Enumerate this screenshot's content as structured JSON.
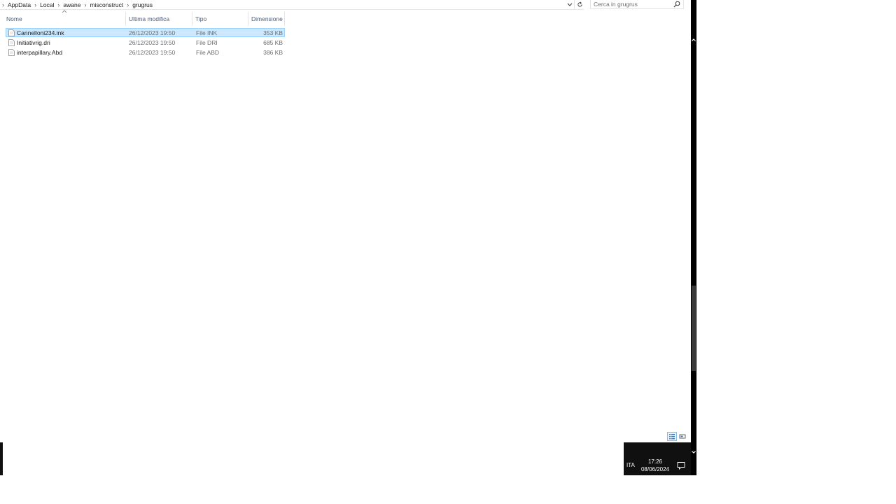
{
  "breadcrumb": [
    "AppData",
    "Local",
    "awane",
    "misconstruct",
    "grugrus"
  ],
  "search": {
    "placeholder": "Cerca in grugrus"
  },
  "columns": {
    "name": "Nome",
    "date": "Ultima modifica",
    "type": "Tipo",
    "size": "Dimensione"
  },
  "files": [
    {
      "name": "Cannelloni234.ink",
      "date": "26/12/2023 19:50",
      "type": "File INK",
      "size": "353 KB",
      "selected": true
    },
    {
      "name": "Initiativrig.dri",
      "date": "26/12/2023 19:50",
      "type": "File DRI",
      "size": "685 KB",
      "selected": false
    },
    {
      "name": "interpapillary.Abd",
      "date": "26/12/2023 19:50",
      "type": "File ABD",
      "size": "386 KB",
      "selected": false
    }
  ],
  "taskbar": {
    "language": "ITA",
    "time": "17:26",
    "date": "08/06/2024"
  },
  "colors": {
    "selection": "#cce8ff",
    "selection_border": "#99d1ff",
    "header_text": "#4c607a",
    "taskbar": "#101010"
  },
  "icons": [
    "chevron-right-icon",
    "chevron-down-icon",
    "refresh-icon",
    "search-icon",
    "sort-up-icon",
    "file-icon",
    "details-view-icon",
    "tiles-view-icon",
    "notification-icon"
  ]
}
